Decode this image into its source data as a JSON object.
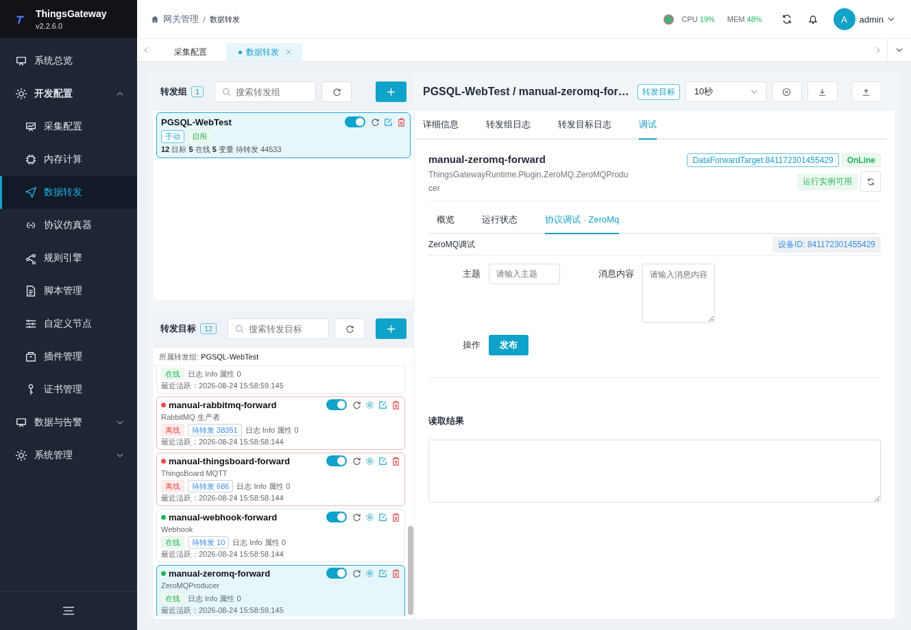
{
  "app": {
    "name": "ThingsGateway",
    "version": "v2.2.6.0"
  },
  "sidebar": {
    "items": [
      {
        "label": "系统总览",
        "kind": "link",
        "selected": false
      },
      {
        "label": "开发配置",
        "kind": "group",
        "expanded": true,
        "children": [
          {
            "label": "采集配置",
            "selected": false
          },
          {
            "label": "内存计算",
            "selected": false
          },
          {
            "label": "数据转发",
            "selected": true
          },
          {
            "label": "协议仿真器",
            "selected": false
          },
          {
            "label": "规则引擎",
            "selected": false
          },
          {
            "label": "脚本管理",
            "selected": false
          },
          {
            "label": "自定义节点",
            "selected": false
          },
          {
            "label": "插件管理",
            "selected": false
          },
          {
            "label": "证书管理",
            "selected": false
          }
        ]
      },
      {
        "label": "数据与告警",
        "kind": "group",
        "expanded": false
      },
      {
        "label": "系统管理",
        "kind": "group",
        "expanded": false
      }
    ]
  },
  "breadcrumb": {
    "separator": "/",
    "items": [
      "网关管理",
      "数据转发"
    ]
  },
  "status": {
    "cpu_label": "CPU",
    "cpu": "19%",
    "mem_label": "MEM",
    "mem": "48%"
  },
  "user": {
    "avatar": "A",
    "name": "admin"
  },
  "page_tabs": [
    {
      "label": "采集配置",
      "selected": false,
      "closable": false
    },
    {
      "label": "数据转发",
      "selected": true,
      "closable": true
    }
  ],
  "groups_panel": {
    "title": "转发组",
    "count": "1",
    "search_placeholder": "搜索转发组",
    "groups": [
      {
        "name": "PGSQL-WebTest",
        "enabled": true,
        "selected": true,
        "tags": [
          {
            "text": "手动",
            "kind": "outline"
          },
          {
            "text": "启用",
            "kind": "success"
          }
        ],
        "stats": "**12** 目标 **5** 在线 **5** 变量 待转发 44533"
      }
    ]
  },
  "targets_panel": {
    "title": "转发目标",
    "count": "12",
    "search_placeholder": "搜索转发目标",
    "group_label": "所属转发组:",
    "group_name": "PGSQL-WebTest",
    "targets": [
      {
        "online": true,
        "status_text": "在线",
        "meta": "日志 Info 属性 0",
        "last_active": "最近活跃：2026-08-24 15:58:59.145",
        "selected": false
      },
      {
        "name": "manual-rabbitmq-forward",
        "online": false,
        "type": "RabbitMQ 生产者",
        "status_text": "离线",
        "pending": "待转发 38351",
        "meta": "日志 Info 属性 0",
        "last_active": "最近活跃：2026-08-24 15:58:58.144",
        "enabled": true,
        "selected": false
      },
      {
        "name": "manual-thingsboard-forward",
        "online": false,
        "type": "ThingsBoard MQTT",
        "status_text": "离线",
        "pending": "待转发 686",
        "meta": "日志 Info 属性 0",
        "last_active": "最近活跃：2026-08-24 15:58:58.144",
        "enabled": true,
        "selected": false
      },
      {
        "name": "manual-webhook-forward",
        "online": true,
        "type": "Webhook",
        "status_text": "在线",
        "pending": "待转发 10",
        "meta": "日志 Info 属性 0",
        "last_active": "最近活跃：2026-08-24 15:58:58.144",
        "enabled": true,
        "selected": false
      },
      {
        "name": "manual-zeromq-forward",
        "online": true,
        "type": "ZeroMQProducer",
        "status_text": "在线",
        "meta": "日志 Info 属性 0",
        "last_active": "最近活跃：2026-08-24 15:58:59.145",
        "enabled": true,
        "selected": true
      }
    ]
  },
  "detail": {
    "title": "PGSQL-WebTest / manual-zeromq-for…",
    "tag": "转发目标",
    "interval": "10秒",
    "tabs": [
      {
        "label": "详细信息",
        "selected": false
      },
      {
        "label": "转发组日志",
        "selected": false
      },
      {
        "label": "转发目标日志",
        "selected": false
      },
      {
        "label": "调试",
        "selected": true
      }
    ],
    "name": "manual-zeromq-forward",
    "plugin": "ThingsGatewayRuntime.Plugin.ZeroMQ.ZeroMQProducer",
    "id_tag": "DataForwardTarget:841172301455429",
    "state": "OnLine",
    "runtime": "运行实例可用",
    "subtabs": [
      {
        "label": "概览",
        "selected": false
      },
      {
        "label": "运行状态",
        "selected": false
      },
      {
        "label": "协议调试 · ZeroMq",
        "selected": true
      }
    ],
    "debug_title": "ZeroMQ调试",
    "device_id": "设备ID: 841172301455429",
    "form": {
      "topic_label": "主题",
      "topic_placeholder": "请输入主题",
      "message_label": "消息内容",
      "message_placeholder": "请输入消息内容",
      "action_label": "操作",
      "publish": "发布"
    },
    "result_label": "读取结果"
  }
}
